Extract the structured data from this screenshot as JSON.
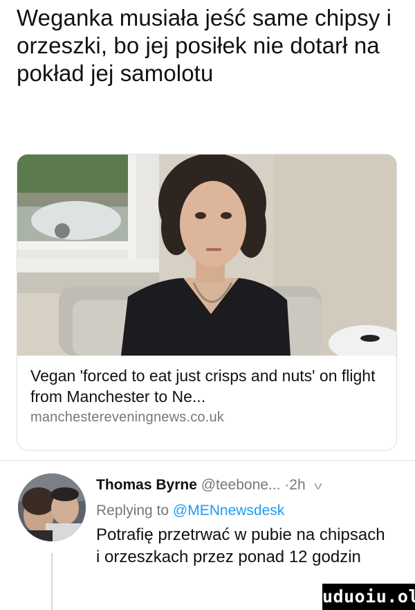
{
  "headline": "Weganka musiała jeść same chipsy i orzeszki, bo jej posiłek nie dotarł na pokład jej samolotu",
  "link_card": {
    "title": "Vegan 'forced to eat just crisps and nuts' on flight from Manchester to Ne...",
    "domain": "manchestereveningnews.co.uk"
  },
  "tweet": {
    "author": "Thomas Byrne",
    "handle": "@teebone...",
    "separator": "·",
    "time": "2h",
    "chevron_icon": "chevron-down-icon",
    "reply_prefix": "Replying to",
    "reply_mention": "@MENnewsdesk",
    "text": "Potrafię przetrwać w pubie na chipsach i orzeszkach przez ponad 12 godzin"
  },
  "watermark": "uduoiu.ol",
  "colors": {
    "text": "#111111",
    "secondary": "#71797f",
    "link": "#1d9bf0",
    "border": "#d9dde1"
  }
}
